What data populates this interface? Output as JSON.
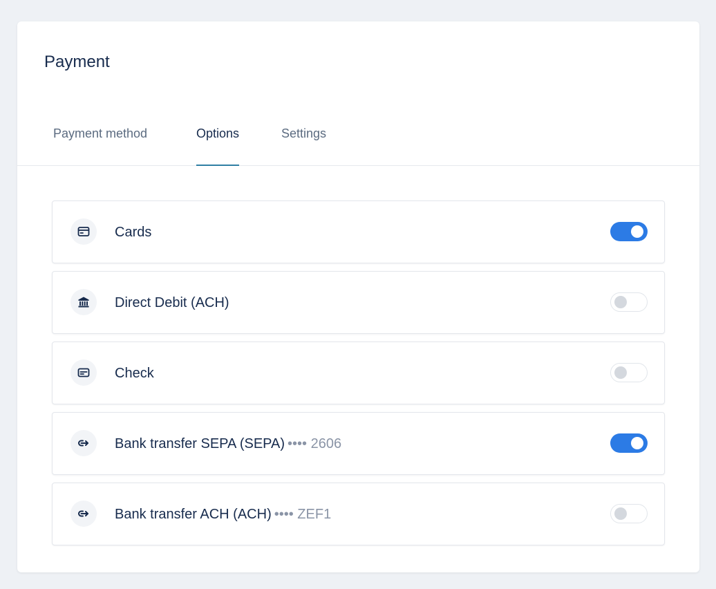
{
  "payment": {
    "title": "Payment",
    "tabs": [
      {
        "label": "Payment method",
        "active": false
      },
      {
        "label": "Options",
        "active": true
      },
      {
        "label": "Settings",
        "active": false
      }
    ],
    "methods": [
      {
        "label": "Cards",
        "masked": "",
        "icon": "credit-card-icon",
        "enabled": true
      },
      {
        "label": "Direct Debit (ACH)",
        "masked": "",
        "icon": "bank-icon",
        "enabled": false
      },
      {
        "label": "Check",
        "masked": "",
        "icon": "check-icon",
        "enabled": false
      },
      {
        "label": "Bank transfer SEPA (SEPA)",
        "masked": "•••• 2606",
        "icon": "transfer-icon",
        "enabled": true
      },
      {
        "label": "Bank transfer ACH (ACH)",
        "masked": "•••• ZEF1",
        "icon": "transfer-icon",
        "enabled": false
      }
    ]
  },
  "colors": {
    "accent": "#2c7be5",
    "tab_underline": "#2f7fa3",
    "text": "#172b4d",
    "muted": "#8a94a6",
    "background": "#eef1f5"
  }
}
